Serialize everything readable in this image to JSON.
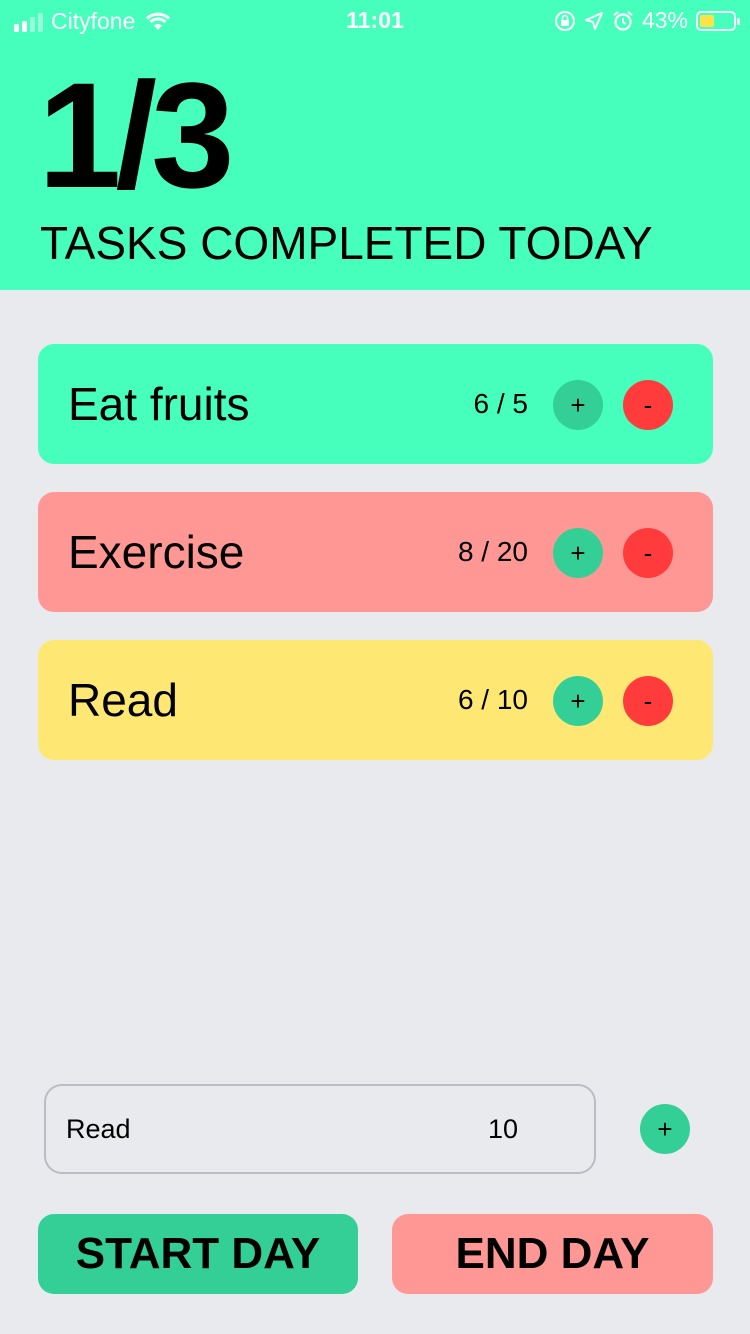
{
  "status_bar": {
    "carrier": "Cityfone",
    "time": "11:01",
    "battery_percent": "43%",
    "battery_level": 0.43,
    "icons": [
      "signal-icon",
      "wifi-icon",
      "rotation-lock-icon",
      "location-icon",
      "alarm-icon",
      "battery-charging-icon"
    ]
  },
  "header": {
    "count": "1/3",
    "subtitle": "TASKS COMPLETED TODAY",
    "color": "#46ffbc"
  },
  "tasks": [
    {
      "name": "Eat fruits",
      "progress": "6 / 5",
      "color": "#46ffbc",
      "plus": "+",
      "minus": "-"
    },
    {
      "name": "Exercise",
      "progress": "8 / 20",
      "color": "#ff9895",
      "plus": "+",
      "minus": "-"
    },
    {
      "name": "Read",
      "progress": "6 / 10",
      "color": "#ffe773",
      "plus": "+",
      "minus": "-"
    }
  ],
  "new_task": {
    "name_value": "Read",
    "target_value": "10",
    "add_label": "+"
  },
  "actions": {
    "start_label": "START DAY",
    "end_label": "END DAY"
  },
  "colors": {
    "background": "#e9eaed",
    "plus_button": "#33cf96",
    "minus_button": "#ff3b3b"
  }
}
